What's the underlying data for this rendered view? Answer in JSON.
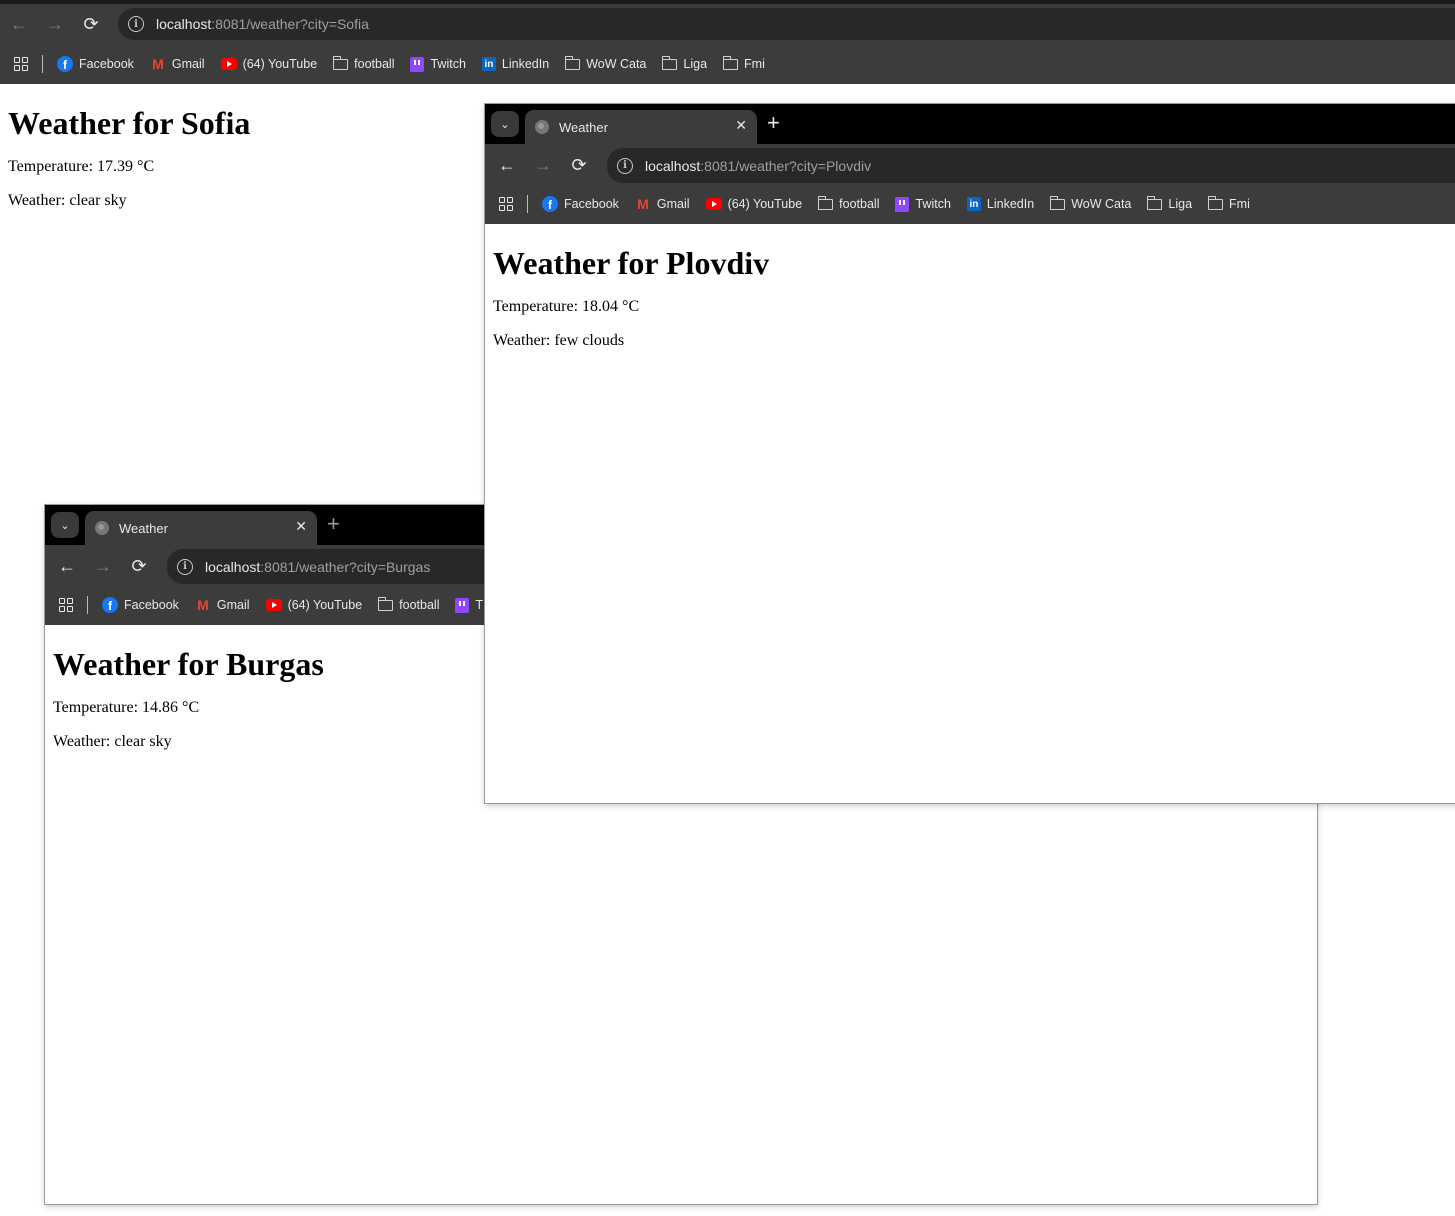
{
  "bookmarks": [
    {
      "label": "Facebook",
      "icon": "facebook-icon"
    },
    {
      "label": "Gmail",
      "icon": "gmail-icon"
    },
    {
      "label": "(64) YouTube",
      "icon": "youtube-icon"
    },
    {
      "label": "football",
      "icon": "folder-icon"
    },
    {
      "label": "Twitch",
      "icon": "twitch-icon"
    },
    {
      "label": "LinkedIn",
      "icon": "linkedin-icon"
    },
    {
      "label": "WoW Cata",
      "icon": "folder-icon"
    },
    {
      "label": "Liga",
      "icon": "folder-icon"
    },
    {
      "label": "Fmi",
      "icon": "folder-icon"
    }
  ],
  "sofia": {
    "url_host": "localhost",
    "url_rest": ":8081/weather?city=Sofia",
    "heading": "Weather for Sofia",
    "temperature": "Temperature: 17.39 °C",
    "weather": "Weather: clear sky"
  },
  "plovdiv": {
    "tab_title": "Weather",
    "url_host": "localhost",
    "url_rest": ":8081/weather?city=Plovdiv",
    "heading": "Weather for Plovdiv",
    "temperature": "Temperature: 18.04 °C",
    "weather": "Weather: few clouds"
  },
  "burgas": {
    "tab_title": "Weather",
    "url_host": "localhost",
    "url_rest": ":8081/weather?city=Burgas",
    "heading": "Weather for Burgas",
    "temperature": "Temperature: 14.86 °C",
    "weather": "Weather: clear sky",
    "visible_bookmarks": [
      {
        "label": "Facebook",
        "icon": "facebook-icon"
      },
      {
        "label": "Gmail",
        "icon": "gmail-icon"
      },
      {
        "label": "(64) YouTube",
        "icon": "youtube-icon"
      },
      {
        "label": "football",
        "icon": "folder-icon"
      },
      {
        "label": "T",
        "icon": "twitch-icon"
      }
    ]
  },
  "icons": {
    "back": "←",
    "forward": "→",
    "reload": "⟳",
    "close": "✕",
    "new_tab": "+",
    "tab_search": "⌄"
  },
  "colors": {
    "toolbar_bg": "#3c3c3c",
    "tabstrip_bg": "#000000",
    "omnibox_bg": "#282828",
    "page_bg": "#ffffff"
  }
}
